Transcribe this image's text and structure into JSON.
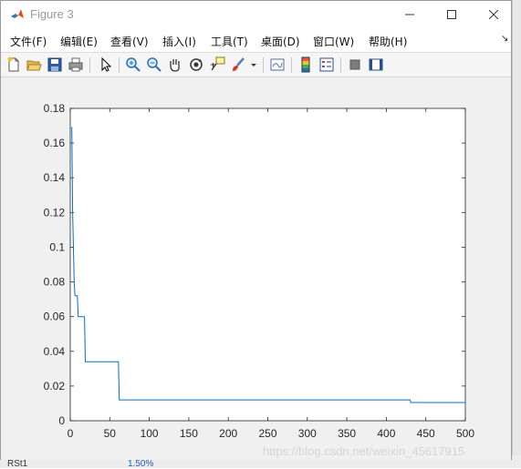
{
  "window": {
    "title": "Figure 3"
  },
  "menu": [
    "文件(F)",
    "编辑(E)",
    "查看(V)",
    "插入(I)",
    "工具(T)",
    "桌面(D)",
    "窗口(W)",
    "帮助(H)"
  ],
  "toolbar_icons": [
    "new-figure-icon",
    "open-file-icon",
    "save-icon",
    "print-icon",
    "edit-plot-icon",
    "zoom-in-icon",
    "zoom-out-icon",
    "pan-icon",
    "rotate-3d-icon",
    "data-cursor-icon",
    "brush-icon",
    "brush-dropdown-icon",
    "link-plot-icon",
    "colorbar-icon",
    "legend-icon",
    "hide-plot-tools-icon",
    "show-plot-tools-icon"
  ],
  "chart_data": {
    "type": "line",
    "title": "",
    "xlabel": "",
    "ylabel": "",
    "xlim": [
      0,
      500
    ],
    "ylim": [
      0,
      0.18
    ],
    "xticks": [
      0,
      50,
      100,
      150,
      200,
      250,
      300,
      350,
      400,
      450,
      500
    ],
    "yticks": [
      "0",
      "0.02",
      "0.04",
      "0.06",
      "0.08",
      "0.1",
      "0.12",
      "0.14",
      "0.16",
      "0.18"
    ],
    "grid": false,
    "series": [
      {
        "color": "#0072bd",
        "x": [
          1,
          2,
          3,
          5,
          6,
          8,
          9,
          10,
          11,
          18,
          19,
          20,
          61,
          62,
          430,
          431,
          500
        ],
        "y": [
          0.169,
          0.169,
          0.12,
          0.08,
          0.072,
          0.072,
          0.072,
          0.06,
          0.06,
          0.06,
          0.034,
          0.034,
          0.034,
          0.012,
          0.012,
          0.0105,
          0.0105
        ]
      }
    ]
  },
  "watermark": "https://blog.csdn.net/weixin_45617915",
  "background": {
    "label": "RSt1",
    "value": "1.50%"
  }
}
